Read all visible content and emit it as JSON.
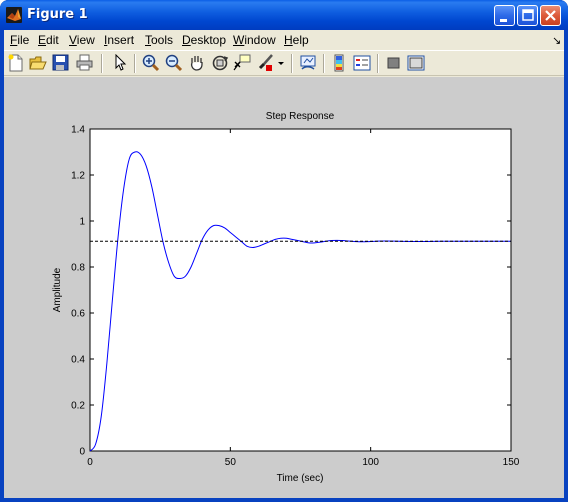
{
  "window": {
    "title": "Figure 1"
  },
  "menu": {
    "items": [
      {
        "pre": "",
        "ul": "F",
        "post": "ile"
      },
      {
        "pre": "",
        "ul": "E",
        "post": "dit"
      },
      {
        "pre": "",
        "ul": "V",
        "post": "iew"
      },
      {
        "pre": "",
        "ul": "I",
        "post": "nsert"
      },
      {
        "pre": "",
        "ul": "T",
        "post": "ools"
      },
      {
        "pre": "",
        "ul": "D",
        "post": "esktop"
      },
      {
        "pre": "",
        "ul": "W",
        "post": "indow"
      },
      {
        "pre": "",
        "ul": "H",
        "post": "elp"
      }
    ],
    "overflow_arrow": "↘"
  },
  "toolbar": {
    "icons": [
      "new-figure-icon",
      "open-file-icon",
      "save-icon",
      "print-icon",
      "edit-plot-arrow-icon",
      "zoom-in-icon",
      "zoom-out-icon",
      "pan-hand-icon",
      "rotate-3d-icon",
      "data-cursor-icon",
      "brush-icon",
      "brush-dropdown-icon",
      "link-plot-icon",
      "colorbar-icon",
      "legend-icon",
      "hide-plot-tools-icon",
      "show-plot-tools-icon"
    ]
  },
  "chart_data": {
    "type": "line",
    "title": "Step Response",
    "xlabel": "Time (sec)",
    "ylabel": "Amplitude",
    "xlim": [
      0,
      150
    ],
    "ylim": [
      0,
      1.4
    ],
    "xticks": [
      0,
      50,
      100,
      150
    ],
    "yticks": [
      0,
      0.2,
      0.4,
      0.6,
      0.8,
      1,
      1.2,
      1.4
    ],
    "ytick_labels": [
      "0",
      "0.2",
      "0.4",
      "0.6",
      "0.8",
      "1",
      "1.2",
      "1.4"
    ],
    "grid": false,
    "series": [
      {
        "style": "solid",
        "color": "#0000ff",
        "x": [
          0,
          2,
          4,
          6,
          8,
          10,
          12,
          14,
          16,
          18,
          20,
          22,
          24,
          26,
          28,
          30,
          32,
          34,
          36,
          38,
          40,
          42,
          44,
          46,
          48,
          50,
          52,
          54,
          56,
          58,
          60,
          62,
          64,
          66,
          68,
          70,
          72,
          74,
          76,
          78,
          80,
          82,
          84,
          86,
          88,
          90,
          92,
          94,
          96,
          98,
          100,
          105,
          110,
          115,
          120,
          125,
          130,
          135,
          140,
          145,
          150
        ],
        "y": [
          0,
          0.03,
          0.15,
          0.38,
          0.66,
          0.93,
          1.14,
          1.27,
          1.3,
          1.29,
          1.24,
          1.15,
          1.03,
          0.91,
          0.82,
          0.76,
          0.75,
          0.76,
          0.8,
          0.86,
          0.92,
          0.96,
          0.98,
          0.98,
          0.97,
          0.95,
          0.93,
          0.91,
          0.89,
          0.885,
          0.89,
          0.9,
          0.91,
          0.92,
          0.925,
          0.925,
          0.92,
          0.915,
          0.91,
          0.905,
          0.905,
          0.908,
          0.912,
          0.915,
          0.916,
          0.915,
          0.913,
          0.911,
          0.91,
          0.91,
          0.911,
          0.913,
          0.912,
          0.911,
          0.911,
          0.912,
          0.912,
          0.912,
          0.912,
          0.912,
          0.912
        ]
      },
      {
        "style": "dashed",
        "color": "#000000",
        "x": [
          0,
          150
        ],
        "y": [
          0.912,
          0.912
        ]
      }
    ]
  }
}
